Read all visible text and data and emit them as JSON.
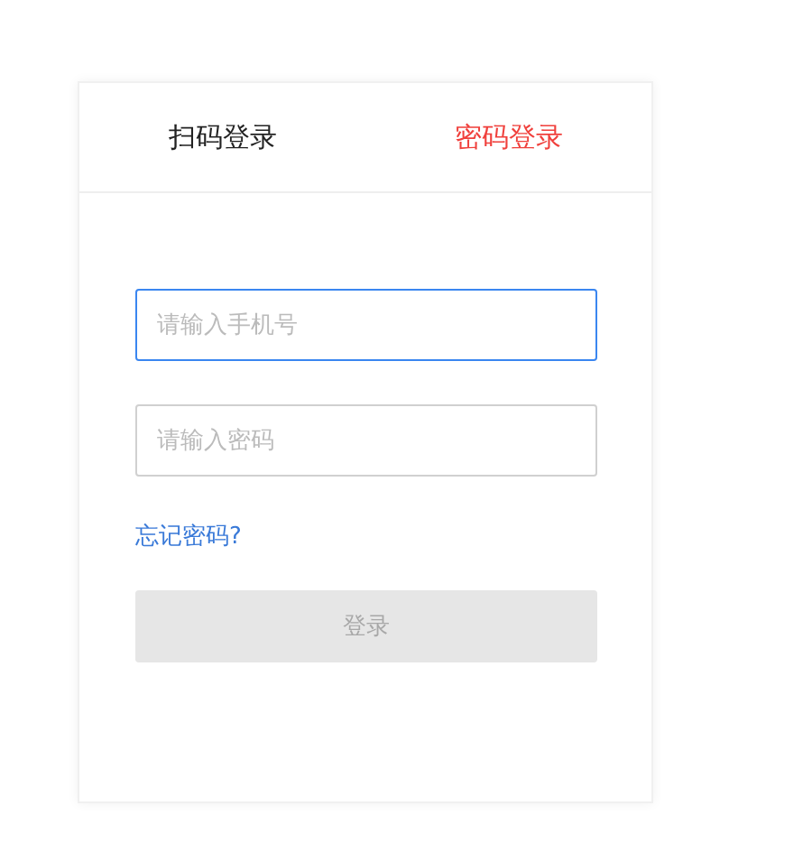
{
  "tabs": [
    {
      "label": "扫码登录",
      "selected": false
    },
    {
      "label": "密码登录",
      "selected": true
    }
  ],
  "phone_field": {
    "placeholder": "请输入手机号",
    "focused": true
  },
  "password_field": {
    "placeholder": "请输入密码",
    "focused": false
  },
  "forgot_link": "忘记密码?",
  "login_button": {
    "label": "登录",
    "disabled": true
  }
}
